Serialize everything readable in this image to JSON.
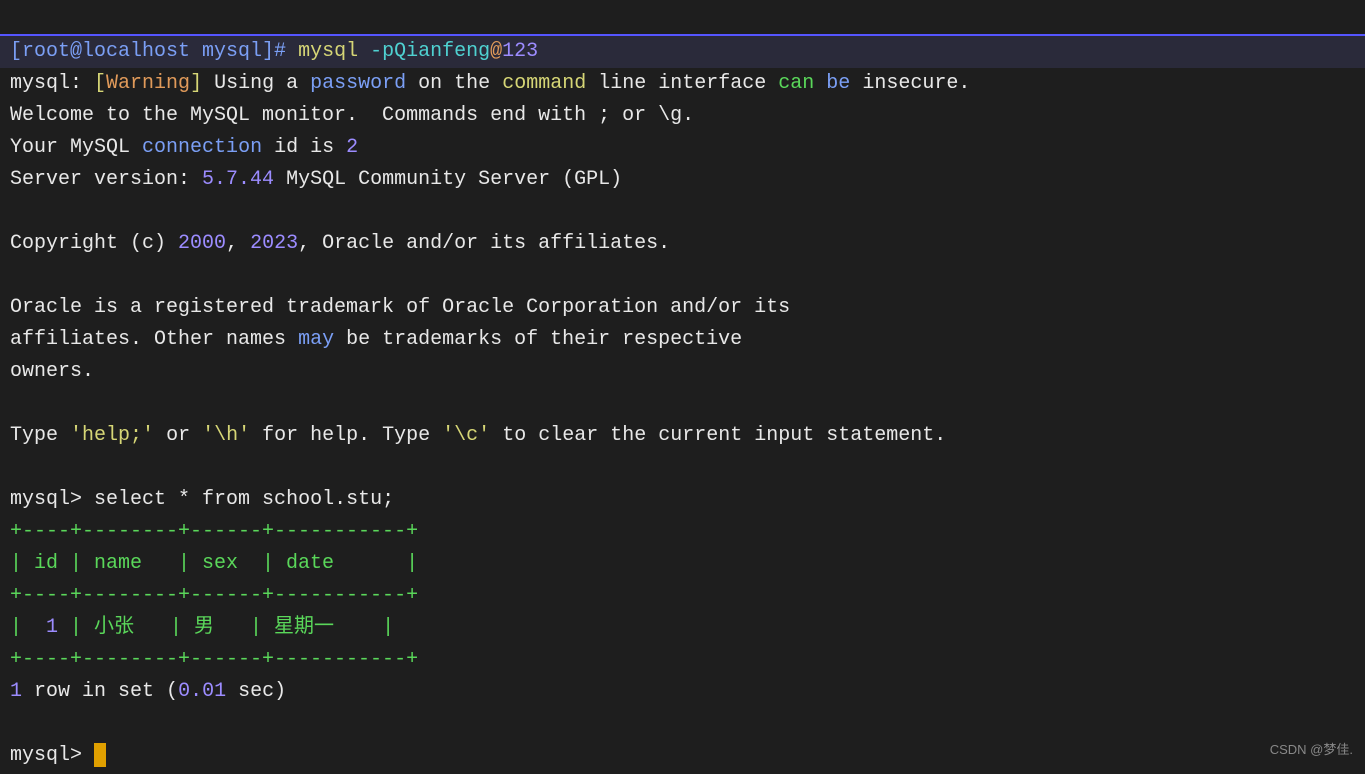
{
  "prompt": {
    "user_host": "[root@localhost mysql]#",
    "cmd": "mysql",
    "flag": "-pQianfeng",
    "at": "@",
    "num": "123"
  },
  "warn": {
    "prefix": "mysql:",
    "open": "[",
    "word": "Warning",
    "close": "]",
    "t1": "Using a",
    "pw": "password",
    "t2": "on the",
    "cmdword": "command",
    "t3": "line interface",
    "can": "can",
    "be": "be",
    "t4": "insecure."
  },
  "welcome1": "Welcome to the MySQL monitor.  Commands end with ; or \\g.",
  "conn": {
    "t1": "Your MySQL",
    "word": "connection",
    "t2": "id is",
    "num": "2"
  },
  "server": {
    "t1": "Server version:",
    "ver": "5.7.44",
    "t2": "MySQL Community Server (GPL)"
  },
  "copy": {
    "t1": "Copyright (c)",
    "y1": "2000",
    "comma": ",",
    "y2": "2023",
    "t2": ", Oracle and/or its affiliates."
  },
  "trade1": "Oracle is a registered trademark of Oracle Corporation and/or its",
  "trade2a": "affiliates. Other names",
  "trade2b": "may",
  "trade2c": "be trademarks of their respective",
  "trade3": "owners.",
  "help": {
    "t1": "Type",
    "s1": "'help;'",
    "t2": "or",
    "s2": "'\\h'",
    "t3": "for help. Type",
    "s3": "'\\c'",
    "t4": "to clear the current input statement."
  },
  "query": {
    "prompt": "mysql>",
    "sql": "select * from school.stu;"
  },
  "table": {
    "border": "+----+--------+------+-----------+",
    "header": "| id | name   | sex  | date      |",
    "row_open": "|  ",
    "row_id": "1",
    "row_rest": " | 小张   | 男   | 星期一    |"
  },
  "result": {
    "num": "1",
    "t1": "row in set (",
    "time": "0.01",
    "t2": "sec)"
  },
  "prompt2": "mysql>",
  "watermark": "CSDN @梦佳."
}
